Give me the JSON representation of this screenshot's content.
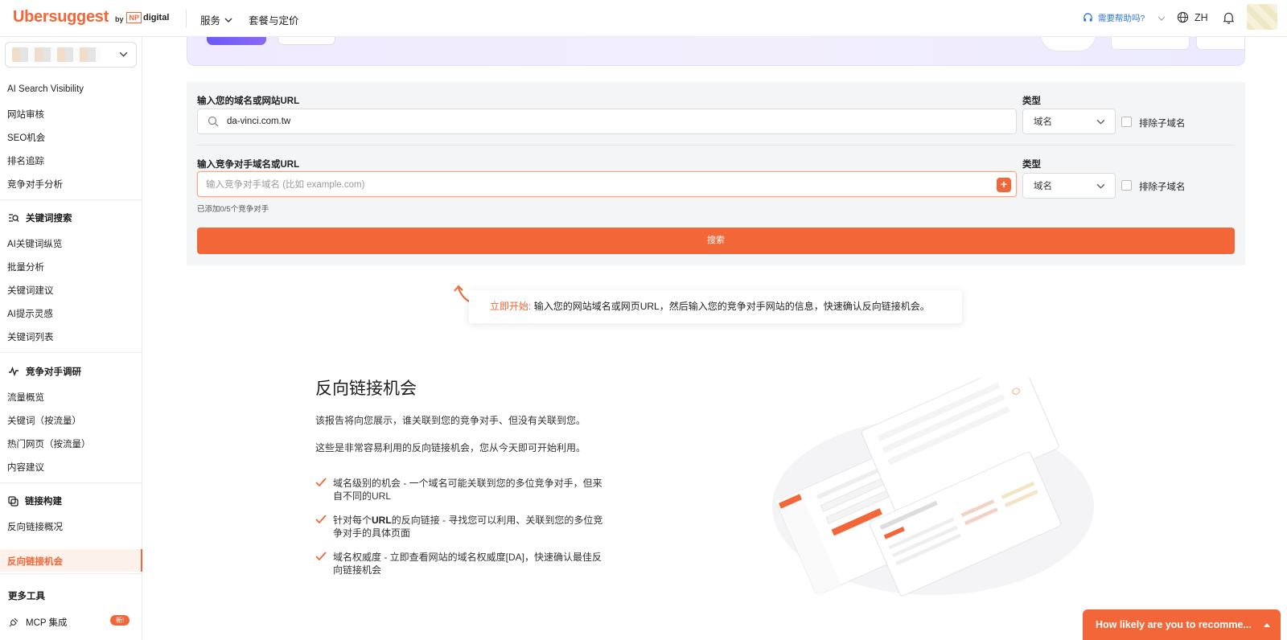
{
  "brand": {
    "name": "Ubersuggest",
    "by": "by",
    "np": "NP",
    "digital": "digital"
  },
  "topnav": {
    "services": "服务",
    "pricing": "套餐与定价",
    "help": "需要帮助吗?",
    "lang": "ZH"
  },
  "sidebar": {
    "group1": [
      {
        "label": "AI Search Visibility"
      },
      {
        "label": "网站审核"
      },
      {
        "label": "SEO机会"
      },
      {
        "label": "排名追踪"
      },
      {
        "label": "竞争对手分析"
      }
    ],
    "keyword_head": "关键词搜索",
    "keyword_items": [
      {
        "label": "AI关键词纵览"
      },
      {
        "label": "批量分析"
      },
      {
        "label": "关键词建议"
      },
      {
        "label": "AI提示灵感"
      },
      {
        "label": "关键词列表"
      }
    ],
    "competitor_head": "竞争对手调研",
    "competitor_items": [
      {
        "label": "流量概览"
      },
      {
        "label": "关键词（按流量）"
      },
      {
        "label": "热门网页（按流量）"
      },
      {
        "label": "内容建议"
      }
    ],
    "link_head": "链接构建",
    "link_items": [
      {
        "label": "反向链接概况"
      },
      {
        "label": "反向链接机会"
      }
    ],
    "more_tools": "更多工具",
    "mcp": "MCP 集成",
    "new_badge": "新!"
  },
  "form": {
    "domain_label": "输入您的域名或网站URL",
    "domain_value": "da-vinci.com.tw",
    "type_label": "类型",
    "type_value": "域名",
    "exclude_sub": "排除子域名",
    "competitor_label": "输入竞争对手域名或URL",
    "competitor_placeholder": "输入竞争对手域名 (比如 example.com)",
    "added_hint": "已添加0/5个竞争对手",
    "search_btn": "搜索"
  },
  "tip": {
    "strong": "立即开始:",
    "text": "输入您的网站域名或网页URL，然后输入您的竞争对手网站的信息，快速确认反向链接机会。"
  },
  "section": {
    "title": "反向链接机会",
    "p1": "该报告将向您展示，谁关联到您的竞争对手、但没有关联到您。",
    "p2": "这些是非常容易利用的反向链接机会，您从今天即可开始利用。",
    "b1_line1": "域名级别的机会 - 一个域名可能关联到您的多位竞争对手，但来",
    "b1_line2": "自不同的URL",
    "b2_pre": "针对每个",
    "b2_bold": "URL",
    "b2_line1": "的反向链接 - 寻找您可以利用、关联到您的多位竞",
    "b2_line2": "争对手的具体页面",
    "b3_line1": "域名权威度 - 立即查看网站的域名权威度[DA]，快速确认最佳反",
    "b3_line2": "向链接机会"
  },
  "feedback": {
    "label": "How likely are you to recomme..."
  },
  "colors": {
    "accent": "#f26638",
    "panel_bg": "#f4f5f6",
    "hero_bg": "#efeaff"
  }
}
